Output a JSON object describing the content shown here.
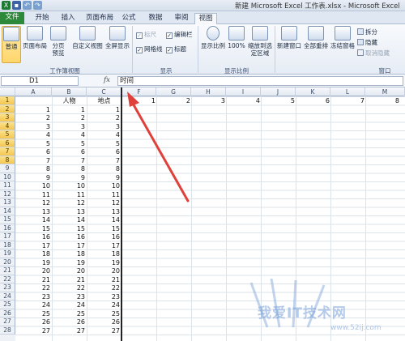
{
  "window": {
    "title": "新建 Microsoft Excel 工作表.xlsx - Microsoft Excel"
  },
  "tabs": [
    "文件",
    "开始",
    "插入",
    "页面布局",
    "公式",
    "数据",
    "审阅",
    "视图"
  ],
  "ribbon": {
    "groups": {
      "workbook_views": "工作簿视图",
      "show": "显示",
      "zoom": "显示比例",
      "window": "窗口"
    },
    "buttons": {
      "normal": "普通",
      "page_layout": "页面布局",
      "page_break": "分页预览",
      "custom_view": "自定义视图",
      "fullscreen": "全屏显示",
      "zoom": "显示比例",
      "zoom100": "100%",
      "zoom_selection": "缩放到选定区域",
      "new_window": "新建窗口",
      "arrange_all": "全部重排",
      "freeze_panes": "冻结窗格",
      "split": "拆分",
      "hide": "隐藏",
      "unhide": "取消隐藏"
    },
    "checkboxes": {
      "ruler": "标尺",
      "formula_bar": "编辑栏",
      "gridlines": "网格线",
      "headings": "标题"
    }
  },
  "formula_bar": {
    "name_box": "D1",
    "fx": "fx",
    "value": "时间"
  },
  "columns": [
    "A",
    "B",
    "C",
    "F",
    "G",
    "H",
    "I",
    "J",
    "K",
    "L",
    "M"
  ],
  "rows": [
    "1",
    "2",
    "3",
    "4",
    "5",
    "6",
    "7",
    "8",
    "9",
    "10",
    "11",
    "12",
    "13",
    "14",
    "15",
    "16",
    "17",
    "18",
    "19",
    "20",
    "21",
    "22",
    "23",
    "24",
    "25",
    "26",
    "27",
    "28"
  ],
  "header_row": {
    "B": "人物",
    "C": "地点"
  },
  "row1_numbers": [
    "1",
    "2",
    "3",
    "4",
    "5",
    "6",
    "7",
    "8"
  ],
  "cells": {
    "A": [
      "1",
      "2",
      "3",
      "4",
      "5",
      "6",
      "7",
      "8",
      "9",
      "10",
      "11",
      "12",
      "13",
      "14",
      "15",
      "16",
      "17",
      "18",
      "19",
      "20",
      "21",
      "22",
      "23",
      "24",
      "25",
      "26",
      "27"
    ],
    "B": [
      "1",
      "2",
      "3",
      "4",
      "5",
      "6",
      "7",
      "8",
      "9",
      "10",
      "11",
      "12",
      "13",
      "14",
      "15",
      "16",
      "17",
      "18",
      "19",
      "20",
      "21",
      "22",
      "23",
      "24",
      "25",
      "26",
      "27"
    ],
    "C": [
      "1",
      "2",
      "3",
      "4",
      "5",
      "6",
      "7",
      "8",
      "9",
      "10",
      "11",
      "12",
      "13",
      "14",
      "15",
      "16",
      "17",
      "18",
      "19",
      "20",
      "21",
      "22",
      "23",
      "24",
      "25",
      "26",
      "27"
    ]
  },
  "watermark": {
    "text": "我爱IT技术网",
    "url": "www.52ij.com"
  },
  "colors": {
    "file_tab": "#2d8a3a",
    "selected_row_header": "#f5c64e",
    "arrow": "#e0403a"
  }
}
